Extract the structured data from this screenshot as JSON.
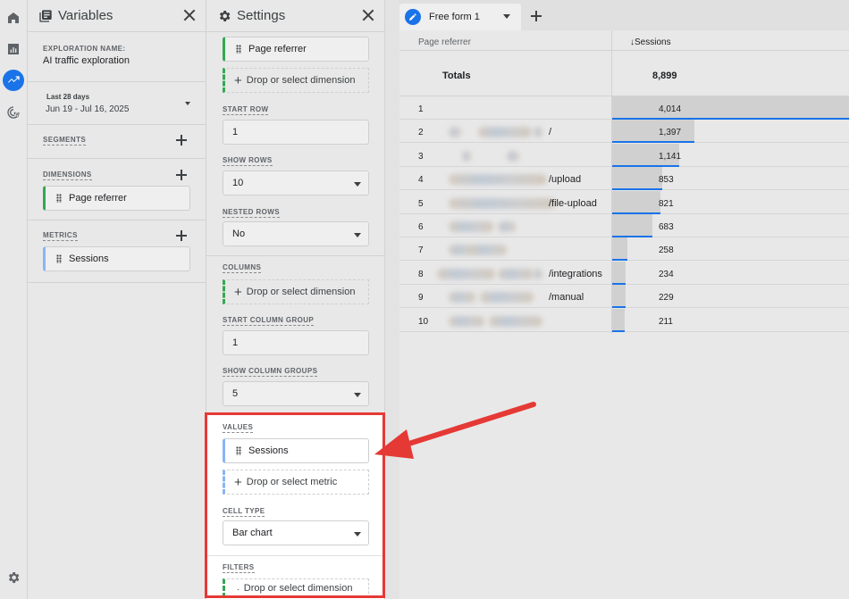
{
  "rail": {
    "icons": [
      "home-icon",
      "reports-icon",
      "explore-icon",
      "advertising-icon",
      "settings-icon"
    ]
  },
  "variables": {
    "title": "Variables",
    "exploration_name_label": "EXPLORATION NAME:",
    "exploration_name": "AI traffic exploration",
    "date_range_label": "Last 28 days",
    "date_range": "Jun 19 - Jul 16, 2025",
    "segments_label": "SEGMENTS",
    "dimensions_label": "DIMENSIONS",
    "dimension_chip": "Page referrer",
    "metrics_label": "METRICS",
    "metric_chip": "Sessions"
  },
  "settings": {
    "title": "Settings",
    "rows_chip": "Page referrer",
    "drop_dimension": "Drop or select dimension",
    "start_row_label": "START ROW",
    "start_row": "1",
    "show_rows_label": "SHOW ROWS",
    "show_rows": "10",
    "nested_rows_label": "NESTED ROWS",
    "nested_rows": "No",
    "columns_label": "COLUMNS",
    "drop_column_dimension": "Drop or select dimension",
    "start_column_group_label": "START COLUMN GROUP",
    "start_column_group": "1",
    "show_column_groups_label": "SHOW COLUMN GROUPS",
    "show_column_groups": "5",
    "values_label": "VALUES",
    "values_chip": "Sessions",
    "drop_metric": "Drop or select metric",
    "cell_type_label": "CELL TYPE",
    "cell_type": "Bar chart",
    "filters_label": "FILTERS",
    "drop_filter": "Drop or select dimension"
  },
  "tab": {
    "label": "Free form 1"
  },
  "table": {
    "col1": "Page referrer",
    "col2": "Sessions",
    "totals_label": "Totals",
    "totals_value": "8,899",
    "max": 4014,
    "rows": [
      {
        "n": "1",
        "suffix": "",
        "value": 4014,
        "value_label": "4,014"
      },
      {
        "n": "2",
        "suffix": "/",
        "value": 1397,
        "value_label": "1,397"
      },
      {
        "n": "3",
        "suffix": "",
        "value": 1141,
        "value_label": "1,141"
      },
      {
        "n": "4",
        "suffix": "/upload",
        "value": 853,
        "value_label": "853"
      },
      {
        "n": "5",
        "suffix": "/file-upload",
        "value": 821,
        "value_label": "821"
      },
      {
        "n": "6",
        "suffix": "",
        "value": 683,
        "value_label": "683"
      },
      {
        "n": "7",
        "suffix": "",
        "value": 258,
        "value_label": "258"
      },
      {
        "n": "8",
        "suffix": "/integrations",
        "value": 234,
        "value_label": "234"
      },
      {
        "n": "9",
        "suffix": "/manual",
        "value": 229,
        "value_label": "229"
      },
      {
        "n": "10",
        "suffix": "",
        "value": 211,
        "value_label": "211"
      }
    ]
  },
  "annotation": {
    "color": "#e53935"
  }
}
